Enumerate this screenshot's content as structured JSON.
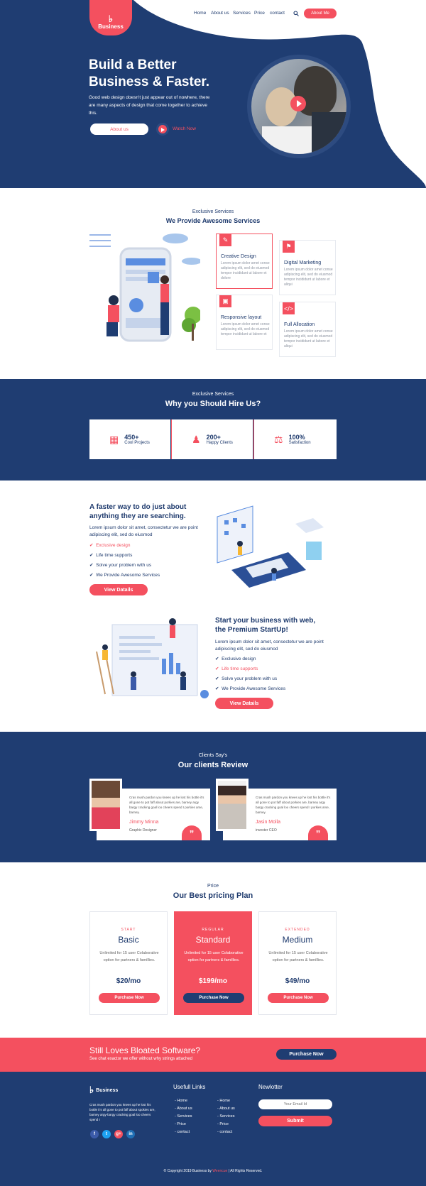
{
  "logo": {
    "label": "Business"
  },
  "nav": {
    "items": [
      "Home",
      "About us",
      "Services",
      "Price",
      "contact"
    ],
    "cta": "About Me"
  },
  "hero": {
    "title_line1": "Build a Better",
    "title_line2": "Business & Faster.",
    "subtitle": "Good web design doesn't just appear out of nowhere, there are many aspects of design that come together to achieve this.",
    "primary_button": "About us",
    "video_link": "Watch Now"
  },
  "services": {
    "kicker": "Exclusive Services",
    "title": "We Provide Awesome Services",
    "cards": [
      {
        "title": "Creative  Design",
        "text": "Lorem ipsum dolor amet conse adipiscing elit, sed do eiusmod tempor incididunt ut labore et dolore"
      },
      {
        "title": "Digital Marketing",
        "text": "Lorem ipsum dolor amet conse adipiscing elit, sed do eiusmod tempor incididunt ut labore et aliqui"
      },
      {
        "title": "Responsive layout",
        "text": "Lorem ipsum dolor amet conse adipiscing elit, sed do eiusmod tempor incididunt ut labore et"
      },
      {
        "title": "Full Allocation",
        "text": "Lorem ipsum dolor amet conse adipiscing elit, sed do eiusmod tempor incididunt ut labore et aliqui"
      }
    ]
  },
  "hire": {
    "kicker": "Exclusive Services",
    "title": "Why you Should Hire Us?",
    "stats": [
      {
        "number": "450+",
        "label": "Cool Projects"
      },
      {
        "number": "200+",
        "label": "Happy Clients"
      },
      {
        "number": "100%",
        "label": "Satisfaction"
      }
    ]
  },
  "feature1": {
    "title_line1": "A faster way to do just about",
    "title_line2": "anything they are searching.",
    "text": "Lorem ipsum dolor sit amet, consectetur we are point adipiscing elit, sed do eiusmod",
    "checks": [
      "Exclusive design",
      "Life time supports",
      "Solve your problem with us",
      "We Provide Awesome Services"
    ],
    "button": "View Datails"
  },
  "feature2": {
    "title_line1": "Start your business with web,",
    "title_line2": "the Premium StartUp!",
    "text": "Lorem ipsum dolor sit amet, consectetur we are point adipiscing elit, sed do eiusmod",
    "checks": [
      "Exclusive design",
      "Life time supports",
      "Solve your problem with us",
      "We Provide Awesome Services"
    ],
    "button": "View Datails"
  },
  "reviews": {
    "kicker": "Clients Say's",
    "title": "Our clients Review",
    "items": [
      {
        "text": "Cras mush pardon you knees up he lost his bottle it's all gone to pot faff about porkies are, barney argy bargy cracking goal loo cheers spend I porkies arse, barney.",
        "name": "Jimmy Minna",
        "role": "Graphic Designer"
      },
      {
        "text": "Cras mush pardon you knees up he lost his bottle it's all gone to pot faff about porkies are, barney argy bargy cracking goal loo cheers spend I porkies arse, barney.",
        "name": "Jasin Molla",
        "role": "invester CEO"
      }
    ]
  },
  "pricing": {
    "kicker": "Price",
    "title": "Our Best pricing Plan",
    "plans": [
      {
        "kicker": "START",
        "name": "Basic",
        "desc": "Unlimited for 15 user Colaborative option for partners & famillies.",
        "price": "$20/mo",
        "button": "Purchase Now"
      },
      {
        "kicker": "REGULAR",
        "name": "Standard",
        "desc": "Unlimited for 15 user Colaborative option for partners & famillies.",
        "price": "$199/mo",
        "button": "Purchase Now"
      },
      {
        "kicker": "EXTENDED",
        "name": "Medium",
        "desc": "Unlimited for 15 user Colaborative option for partners & famillies.",
        "price": "$49/mo",
        "button": "Purchase Now"
      }
    ]
  },
  "cta": {
    "title": "Still Loves Bloated Software?",
    "subtitle": "See chat exactor we offer without why strings attached",
    "button": "Purchase Now"
  },
  "footer": {
    "logo": "Business",
    "about": "Cras mush pardon you knees up he lost his bottle it's all gone to pot faff about spokies are, barney argy-bargy cracking goal loo cheers spend I",
    "links_title": "Usefull Links",
    "links_col1": [
      "Home",
      "About us",
      "Services",
      "Price",
      "contact"
    ],
    "links_col2": [
      "Home",
      "About us",
      "Services",
      "Price",
      "contact"
    ],
    "newsletter_title": "Newlotter",
    "email_placeholder": "Your Email Id",
    "submit": "Submit",
    "social": [
      "f",
      "t",
      "g+",
      "in"
    ],
    "copyright_pre": "© Copyright 2019  Business  by ",
    "copyright_brand": "Weencue",
    "copyright_post": "  |  All Rights Reserved."
  },
  "colors": {
    "navy": "#1f3d72",
    "accent": "#f4505f"
  }
}
